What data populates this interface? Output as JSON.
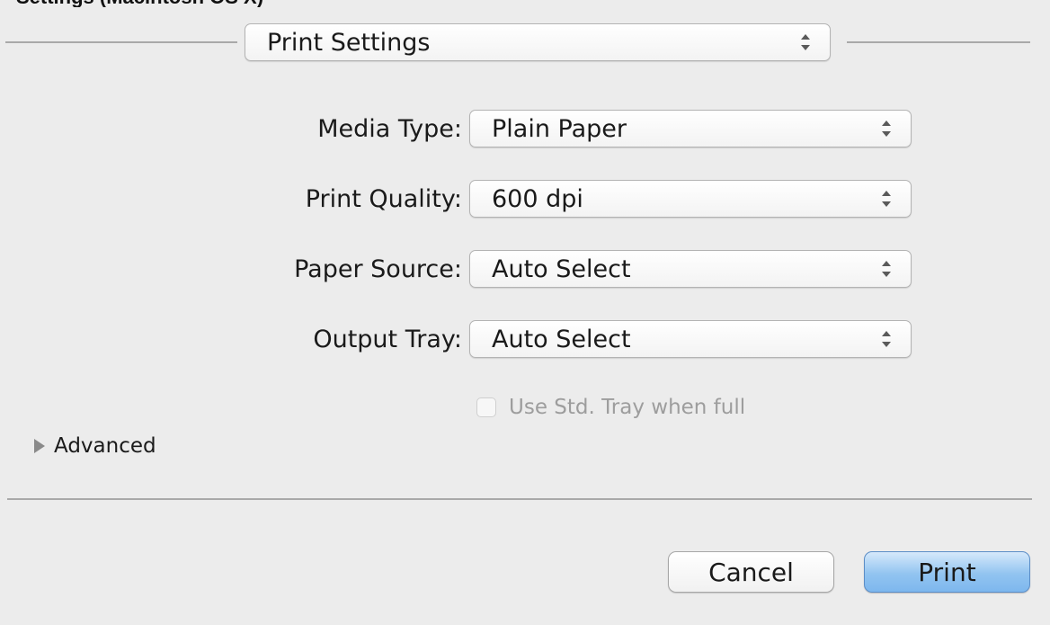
{
  "window": {
    "title": "Settings (Macintosh OS X)"
  },
  "section_menu": {
    "value": "Print Settings",
    "icon": "up-down-arrows-icon"
  },
  "fields": [
    {
      "label": "Media Type:",
      "value": "Plain Paper"
    },
    {
      "label": "Print Quality:",
      "value": "600 dpi"
    },
    {
      "label": "Paper Source:",
      "value": "Auto Select"
    },
    {
      "label": "Output Tray:",
      "value": "Auto Select"
    }
  ],
  "std_tray_checkbox": {
    "label": "Use Std. Tray when full",
    "checked": false,
    "enabled": false
  },
  "advanced": {
    "label": "Advanced",
    "expanded": false,
    "icon": "disclosure-triangle-icon"
  },
  "buttons": {
    "cancel_label": "Cancel",
    "print_label": "Print"
  },
  "colors": {
    "background": "#ececec",
    "default_button": "#92c4f0",
    "disabled_text": "#9d9d9d"
  }
}
